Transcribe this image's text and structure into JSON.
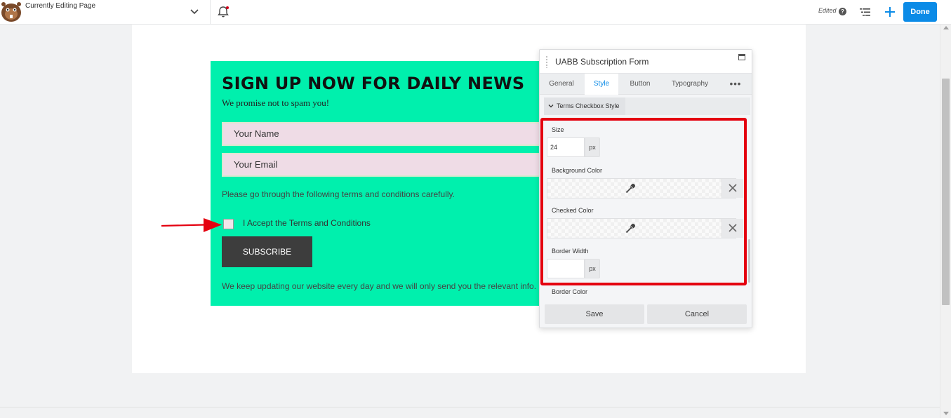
{
  "topbar": {
    "page_title": "Currently Editing Page",
    "status_text": "Edited",
    "help_glyph": "?",
    "done_label": "Done",
    "accent_color": "#0b8be7"
  },
  "form": {
    "heading": "SIGN UP NOW FOR DAILY NEWS",
    "subheading": "We promise not to spam you!",
    "name_placeholder": "Your Name",
    "email_placeholder": "Your Email",
    "terms_intro": "Please go through the following terms and conditions carefully.",
    "checkbox_label": "I Accept the Terms and Conditions",
    "subscribe_label": "SUBSCRIBE",
    "footer_note": "We keep updating our website every day and we will only send you the relevant info.",
    "background_color": "#00f0ad"
  },
  "panel": {
    "title": "UABB Subscription Form",
    "tabs": [
      "General",
      "Style",
      "Button",
      "Typography",
      "•••"
    ],
    "active_tab": "Style",
    "section_title": "Terms Checkbox Style",
    "fields": {
      "size_label": "Size",
      "size_value": "24",
      "size_unit": "px",
      "background_color_label": "Background Color",
      "checked_color_label": "Checked Color",
      "border_width_label": "Border Width",
      "border_width_value": "",
      "border_width_unit": "px",
      "border_color_label": "Border Color"
    },
    "save_label": "Save",
    "cancel_label": "Cancel"
  },
  "annotations": {
    "highlight_color": "#e4000f"
  }
}
